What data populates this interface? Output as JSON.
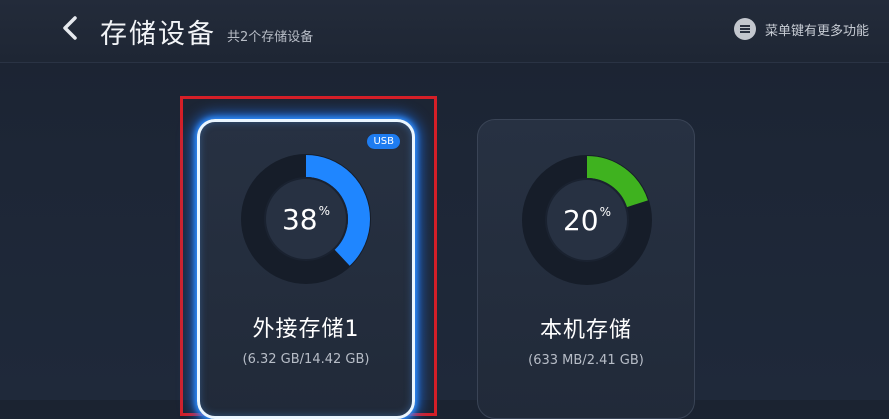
{
  "header": {
    "title": "存储设备",
    "subtitle": "共2个存储设备",
    "menu_hint": "菜单键有更多功能"
  },
  "devices": [
    {
      "badge": "USB",
      "percent": "38",
      "percent_sign": "%",
      "usage": 0.38,
      "name": "外接存储1",
      "size": "(6.32 GB/14.42 GB)",
      "color": "#1f86ff",
      "selected": true
    },
    {
      "percent": "20",
      "percent_sign": "%",
      "usage": 0.2,
      "name": "本机存储",
      "size": "(633 MB/2.41 GB)",
      "color": "#3fb21f",
      "selected": false
    }
  ],
  "colors": {
    "selection_frame": "#d51f27",
    "glow": "#2f8fff"
  }
}
